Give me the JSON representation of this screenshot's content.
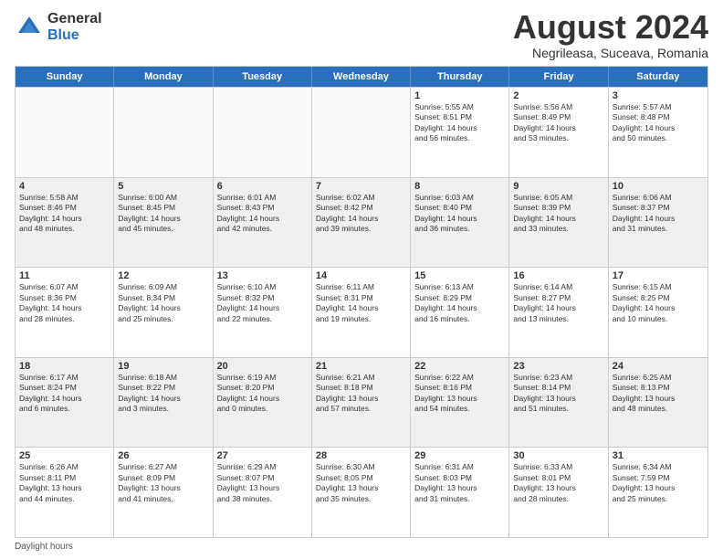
{
  "logo": {
    "general": "General",
    "blue": "Blue"
  },
  "title": "August 2024",
  "subtitle": "Negrileasa, Suceava, Romania",
  "days": [
    "Sunday",
    "Monday",
    "Tuesday",
    "Wednesday",
    "Thursday",
    "Friday",
    "Saturday"
  ],
  "weeks": [
    [
      {
        "day": "",
        "empty": true
      },
      {
        "day": "",
        "empty": true
      },
      {
        "day": "",
        "empty": true
      },
      {
        "day": "",
        "empty": true
      },
      {
        "day": "1",
        "lines": [
          "Sunrise: 5:55 AM",
          "Sunset: 8:51 PM",
          "Daylight: 14 hours",
          "and 56 minutes."
        ]
      },
      {
        "day": "2",
        "lines": [
          "Sunrise: 5:56 AM",
          "Sunset: 8:49 PM",
          "Daylight: 14 hours",
          "and 53 minutes."
        ]
      },
      {
        "day": "3",
        "lines": [
          "Sunrise: 5:57 AM",
          "Sunset: 8:48 PM",
          "Daylight: 14 hours",
          "and 50 minutes."
        ]
      }
    ],
    [
      {
        "day": "4",
        "lines": [
          "Sunrise: 5:58 AM",
          "Sunset: 8:46 PM",
          "Daylight: 14 hours",
          "and 48 minutes."
        ]
      },
      {
        "day": "5",
        "lines": [
          "Sunrise: 6:00 AM",
          "Sunset: 8:45 PM",
          "Daylight: 14 hours",
          "and 45 minutes."
        ]
      },
      {
        "day": "6",
        "lines": [
          "Sunrise: 6:01 AM",
          "Sunset: 8:43 PM",
          "Daylight: 14 hours",
          "and 42 minutes."
        ]
      },
      {
        "day": "7",
        "lines": [
          "Sunrise: 6:02 AM",
          "Sunset: 8:42 PM",
          "Daylight: 14 hours",
          "and 39 minutes."
        ]
      },
      {
        "day": "8",
        "lines": [
          "Sunrise: 6:03 AM",
          "Sunset: 8:40 PM",
          "Daylight: 14 hours",
          "and 36 minutes."
        ]
      },
      {
        "day": "9",
        "lines": [
          "Sunrise: 6:05 AM",
          "Sunset: 8:39 PM",
          "Daylight: 14 hours",
          "and 33 minutes."
        ]
      },
      {
        "day": "10",
        "lines": [
          "Sunrise: 6:06 AM",
          "Sunset: 8:37 PM",
          "Daylight: 14 hours",
          "and 31 minutes."
        ]
      }
    ],
    [
      {
        "day": "11",
        "lines": [
          "Sunrise: 6:07 AM",
          "Sunset: 8:36 PM",
          "Daylight: 14 hours",
          "and 28 minutes."
        ]
      },
      {
        "day": "12",
        "lines": [
          "Sunrise: 6:09 AM",
          "Sunset: 8:34 PM",
          "Daylight: 14 hours",
          "and 25 minutes."
        ]
      },
      {
        "day": "13",
        "lines": [
          "Sunrise: 6:10 AM",
          "Sunset: 8:32 PM",
          "Daylight: 14 hours",
          "and 22 minutes."
        ]
      },
      {
        "day": "14",
        "lines": [
          "Sunrise: 6:11 AM",
          "Sunset: 8:31 PM",
          "Daylight: 14 hours",
          "and 19 minutes."
        ]
      },
      {
        "day": "15",
        "lines": [
          "Sunrise: 6:13 AM",
          "Sunset: 8:29 PM",
          "Daylight: 14 hours",
          "and 16 minutes."
        ]
      },
      {
        "day": "16",
        "lines": [
          "Sunrise: 6:14 AM",
          "Sunset: 8:27 PM",
          "Daylight: 14 hours",
          "and 13 minutes."
        ]
      },
      {
        "day": "17",
        "lines": [
          "Sunrise: 6:15 AM",
          "Sunset: 8:25 PM",
          "Daylight: 14 hours",
          "and 10 minutes."
        ]
      }
    ],
    [
      {
        "day": "18",
        "lines": [
          "Sunrise: 6:17 AM",
          "Sunset: 8:24 PM",
          "Daylight: 14 hours",
          "and 6 minutes."
        ]
      },
      {
        "day": "19",
        "lines": [
          "Sunrise: 6:18 AM",
          "Sunset: 8:22 PM",
          "Daylight: 14 hours",
          "and 3 minutes."
        ]
      },
      {
        "day": "20",
        "lines": [
          "Sunrise: 6:19 AM",
          "Sunset: 8:20 PM",
          "Daylight: 14 hours",
          "and 0 minutes."
        ]
      },
      {
        "day": "21",
        "lines": [
          "Sunrise: 6:21 AM",
          "Sunset: 8:18 PM",
          "Daylight: 13 hours",
          "and 57 minutes."
        ]
      },
      {
        "day": "22",
        "lines": [
          "Sunrise: 6:22 AM",
          "Sunset: 8:16 PM",
          "Daylight: 13 hours",
          "and 54 minutes."
        ]
      },
      {
        "day": "23",
        "lines": [
          "Sunrise: 6:23 AM",
          "Sunset: 8:14 PM",
          "Daylight: 13 hours",
          "and 51 minutes."
        ]
      },
      {
        "day": "24",
        "lines": [
          "Sunrise: 6:25 AM",
          "Sunset: 8:13 PM",
          "Daylight: 13 hours",
          "and 48 minutes."
        ]
      }
    ],
    [
      {
        "day": "25",
        "lines": [
          "Sunrise: 6:26 AM",
          "Sunset: 8:11 PM",
          "Daylight: 13 hours",
          "and 44 minutes."
        ]
      },
      {
        "day": "26",
        "lines": [
          "Sunrise: 6:27 AM",
          "Sunset: 8:09 PM",
          "Daylight: 13 hours",
          "and 41 minutes."
        ]
      },
      {
        "day": "27",
        "lines": [
          "Sunrise: 6:29 AM",
          "Sunset: 8:07 PM",
          "Daylight: 13 hours",
          "and 38 minutes."
        ]
      },
      {
        "day": "28",
        "lines": [
          "Sunrise: 6:30 AM",
          "Sunset: 8:05 PM",
          "Daylight: 13 hours",
          "and 35 minutes."
        ]
      },
      {
        "day": "29",
        "lines": [
          "Sunrise: 6:31 AM",
          "Sunset: 8:03 PM",
          "Daylight: 13 hours",
          "and 31 minutes."
        ]
      },
      {
        "day": "30",
        "lines": [
          "Sunrise: 6:33 AM",
          "Sunset: 8:01 PM",
          "Daylight: 13 hours",
          "and 28 minutes."
        ]
      },
      {
        "day": "31",
        "lines": [
          "Sunrise: 6:34 AM",
          "Sunset: 7:59 PM",
          "Daylight: 13 hours",
          "and 25 minutes."
        ]
      }
    ]
  ],
  "footer": "Daylight hours"
}
